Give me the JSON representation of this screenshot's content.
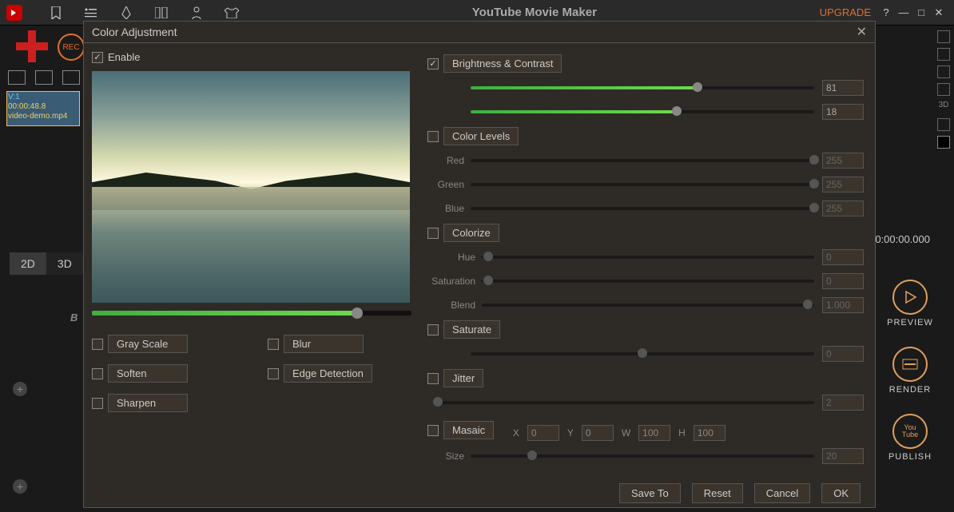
{
  "app": {
    "title": "YouTube Movie Maker",
    "upgrade": "UPGRADE"
  },
  "background": {
    "rec": "REC",
    "clip": {
      "track": "V:1",
      "time": "00:00:48.8",
      "name": "video-demo.mp4"
    },
    "tabs": {
      "tab2d": "2D",
      "tab3d": "3D"
    },
    "label_b": "B",
    "timestamp": "0:00:00.000",
    "buttons": {
      "preview": "PREVIEW",
      "render": "RENDER",
      "publish": "PUBLISH"
    },
    "right_icons": {
      "three_d": "3D"
    }
  },
  "dialog": {
    "title": "Color Adjustment",
    "enable": {
      "label": "Enable",
      "checked": true
    },
    "preview_slider": 83,
    "effects": {
      "gray": "Gray Scale",
      "soften": "Soften",
      "sharpen": "Sharpen",
      "blur": "Blur",
      "edge": "Edge Detection"
    },
    "brightness": {
      "label": "Brightness & Contrast",
      "checked": true,
      "brightness": {
        "value": "81",
        "pct": 66
      },
      "contrast": {
        "value": "18",
        "pct": 60
      }
    },
    "color_levels": {
      "label": "Color Levels",
      "red": {
        "label": "Red",
        "value": "255",
        "pct": 100
      },
      "green": {
        "label": "Green",
        "value": "255",
        "pct": 100
      },
      "blue": {
        "label": "Blue",
        "value": "255",
        "pct": 100
      }
    },
    "colorize": {
      "label": "Colorize",
      "hue": {
        "label": "Hue",
        "value": "0",
        "pct": 2
      },
      "saturation": {
        "label": "Saturation",
        "value": "0",
        "pct": 2
      },
      "blend": {
        "label": "Blend",
        "value": "1.000",
        "pct": 98
      }
    },
    "saturate": {
      "label": "Saturate",
      "value": "0",
      "pct": 50
    },
    "jitter": {
      "label": "Jitter",
      "value": "2",
      "pct": 1
    },
    "mosaic": {
      "label": "Masaic",
      "x": {
        "label": "X",
        "value": "0"
      },
      "y": {
        "label": "Y",
        "value": "0"
      },
      "w": {
        "label": "W",
        "value": "100"
      },
      "h": {
        "label": "H",
        "value": "100"
      },
      "size": {
        "label": "Size",
        "value": "20",
        "pct": 18
      }
    },
    "footer": {
      "save_to": "Save To",
      "reset": "Reset",
      "cancel": "Cancel",
      "ok": "OK"
    }
  }
}
